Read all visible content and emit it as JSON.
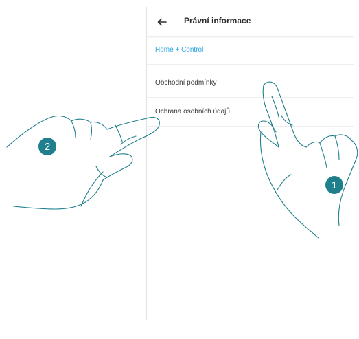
{
  "header": {
    "back_icon": "arrow-left-icon",
    "title": "Právní informace"
  },
  "menu": {
    "items": [
      {
        "label": "Home + Control",
        "highlight": true
      },
      {
        "label": "Obchodní podmínky",
        "highlight": false
      },
      {
        "label": "Ochrana osobních údajů",
        "highlight": false
      }
    ]
  },
  "callouts": {
    "step_1": "1",
    "step_2": "2"
  },
  "colors": {
    "accent": "#2ba6df",
    "badge": "#1f7f8c",
    "hand_outline": "#1f7f8c"
  }
}
